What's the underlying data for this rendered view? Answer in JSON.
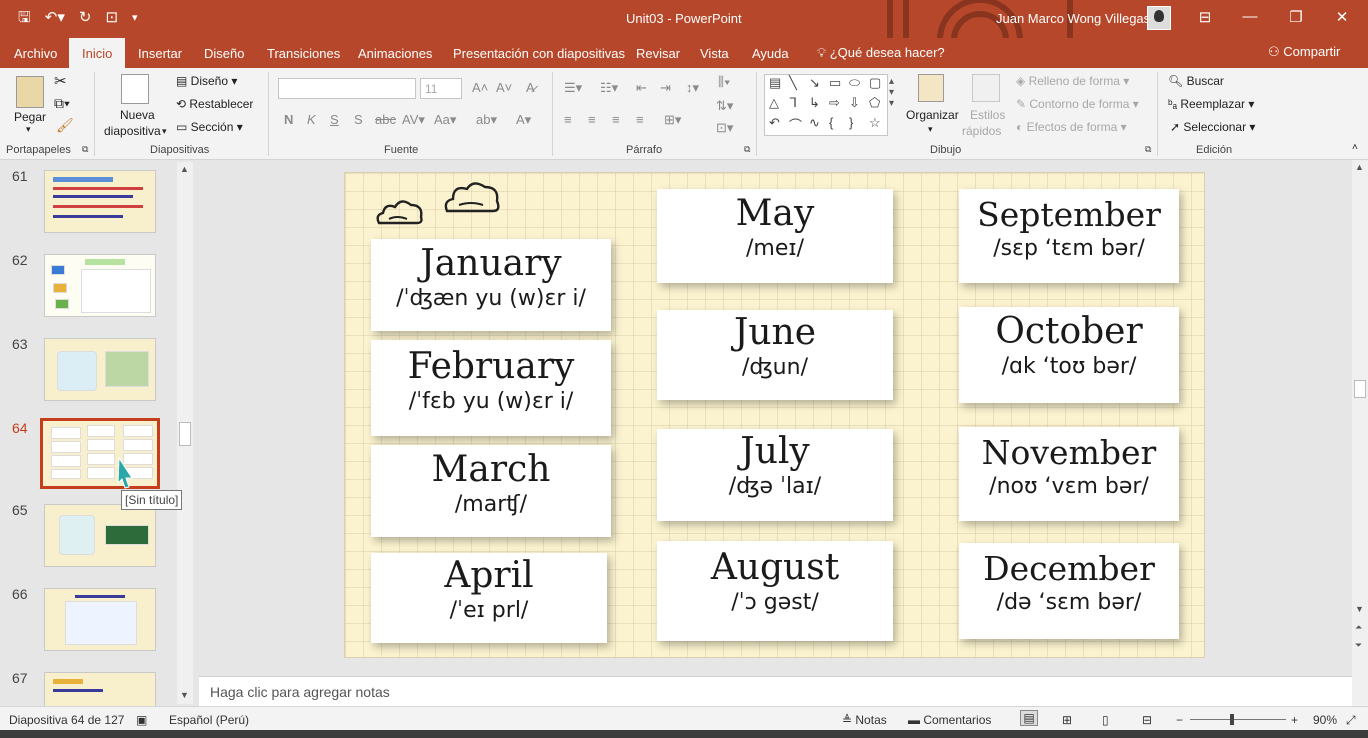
{
  "window": {
    "title": "Unit03  -  PowerPoint",
    "user": "Juan Marco Wong Villegas"
  },
  "tabs": [
    "Archivo",
    "Inicio",
    "Insertar",
    "Diseño",
    "Transiciones",
    "Animaciones",
    "Presentación con diapositivas",
    "Revisar",
    "Vista",
    "Ayuda"
  ],
  "tell_me": "¿Qué desea hacer?",
  "share": "Compartir",
  "ribbon": {
    "clipboard": {
      "paste": "Pegar",
      "label": "Portapapeles"
    },
    "slides": {
      "new_slide_1": "Nueva",
      "new_slide_2": "diapositiva",
      "layout": "Diseño",
      "reset": "Restablecer",
      "section": "Sección",
      "label": "Diapositivas"
    },
    "font": {
      "label": "Fuente",
      "size": "11"
    },
    "paragraph": {
      "label": "Párrafo"
    },
    "drawing": {
      "arrange": "Organizar",
      "styles_1": "Estilos",
      "styles_2": "rápidos",
      "fill": "Relleno de forma",
      "outline": "Contorno de forma",
      "effects": "Efectos de forma",
      "label": "Dibujo"
    },
    "editing": {
      "find": "Buscar",
      "replace": "Reemplazar",
      "select": "Seleccionar",
      "label": "Edición"
    }
  },
  "thumbnails": [
    {
      "num": "61"
    },
    {
      "num": "62"
    },
    {
      "num": "63"
    },
    {
      "num": "64"
    },
    {
      "num": "65"
    },
    {
      "num": "66"
    },
    {
      "num": "67"
    }
  ],
  "tooltip": "[Sin título]",
  "slide": {
    "cards": [
      {
        "month": "January",
        "phon": "/ˈʤæn yu (w)ɛr i/"
      },
      {
        "month": "February",
        "phon": "/ˈfɛb yu (w)ɛr i/"
      },
      {
        "month": "March",
        "phon": "/marʧ/"
      },
      {
        "month": "April",
        "phon": "/ˈeɪ prl/"
      },
      {
        "month": "May",
        "phon": "/meɪ/"
      },
      {
        "month": "June",
        "phon": "/ʤun/"
      },
      {
        "month": "July",
        "phon": "/ʤə ˈlaɪ/"
      },
      {
        "month": "August",
        "phon": "/ˈɔ gəst/"
      },
      {
        "month": "September",
        "phon": "/sɛp ‘tɛm bər/"
      },
      {
        "month": "October",
        "phon": "/ɑk ‘toʊ bər/"
      },
      {
        "month": "November",
        "phon": "/noʊ ‘vɛm bər/"
      },
      {
        "month": "December",
        "phon": "/də ‘sɛm bər/"
      }
    ]
  },
  "notes_placeholder": "Haga clic para agregar notas",
  "status": {
    "slide_count": "Diapositiva 64 de 127",
    "language": "Español (Perú)",
    "notes": "Notas",
    "comments": "Comentarios",
    "zoom": "90%"
  }
}
